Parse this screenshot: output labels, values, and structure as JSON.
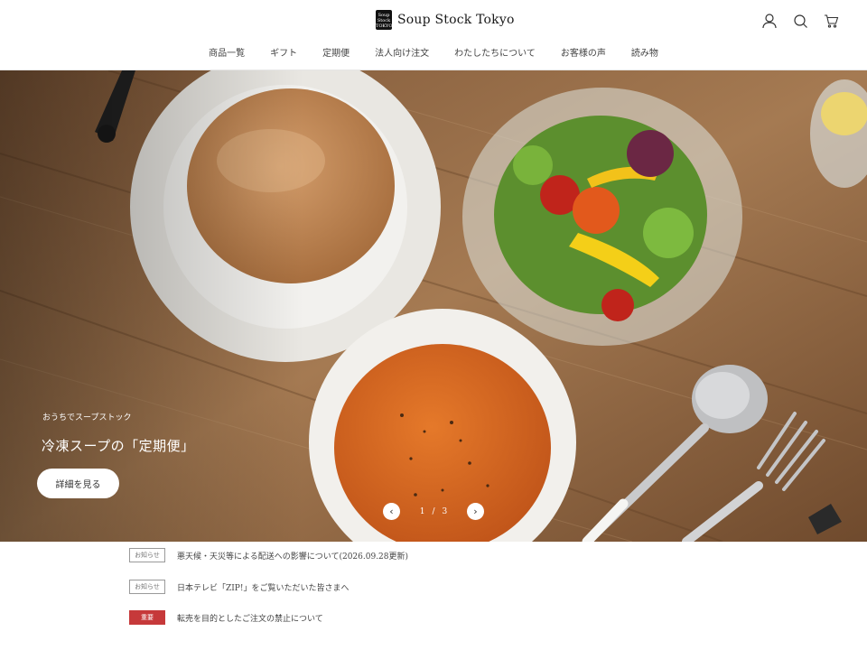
{
  "header": {
    "logo_mark": "Soup Stock TOKYO",
    "brand": "Soup Stock Tokyo",
    "icons": [
      "account-icon",
      "search-icon",
      "cart-icon"
    ]
  },
  "nav": {
    "items": [
      {
        "label": "商品一覧"
      },
      {
        "label": "ギフト"
      },
      {
        "label": "定期便"
      },
      {
        "label": "法人向け注文"
      },
      {
        "label": "わたしたちについて"
      },
      {
        "label": "お客様の声"
      },
      {
        "label": "読み物"
      }
    ]
  },
  "hero": {
    "eyebrow": "おうちでスープストック",
    "title": "冷凍スープの「定期便」",
    "button": "詳細を見る",
    "slide_current": "1",
    "slide_separator": "/",
    "slide_total": "3",
    "prev_label": "‹",
    "next_label": "›"
  },
  "notices": [
    {
      "badge": "お知らせ",
      "type": "info",
      "text": "悪天候・天災等による配送への影響について(2026.09.28更新)"
    },
    {
      "badge": "お知らせ",
      "type": "info",
      "text": "日本テレビ「ZIP!」をご覧いただいた皆さまへ"
    },
    {
      "badge": "重要",
      "type": "important",
      "text": "転売を目的としたご注文の禁止について"
    }
  ],
  "colors": {
    "important": "#c6393a",
    "wood": "#8a6440",
    "soup": "#d9691f"
  }
}
